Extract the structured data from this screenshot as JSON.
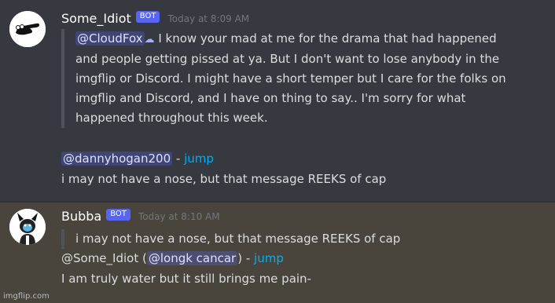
{
  "messages": [
    {
      "username": "Some_Idiot",
      "bot_tag": "BOT",
      "timestamp": "Today at 8:09 AM",
      "quote": {
        "mention": "@CloudFox",
        "text": " I know your mad at me for the drama that had happened and people getting pissed at ya. But I don't want to lose anybody in the imgflip or Discord. I might have a short temper but I care for the folks on imgflip and Discord, and I have on thing to say.. I'm sorry for what happened throughout this week."
      },
      "reply_ref": {
        "mention": "@dannyhogan200",
        "dash": " - ",
        "jump": "jump"
      },
      "body": "i may not have a nose, but that message REEKS of cap"
    },
    {
      "username": "Bubba",
      "bot_tag": "BOT",
      "timestamp": "Today at 8:10 AM",
      "quote": {
        "text": "i may not have a nose, but that message REEKS of cap"
      },
      "reply_ref": {
        "prefix": "@Some_Idiot (",
        "mention": "@longk cancar",
        "suffix": ") - ",
        "jump": "jump"
      },
      "body": " I am truly water but it still brings me pain-"
    }
  ],
  "watermark": "imgflip.com",
  "colors": {
    "background": "#36393f",
    "highlight": "#49443c",
    "link": "#00aff4",
    "bot_tag": "#5865f2"
  }
}
